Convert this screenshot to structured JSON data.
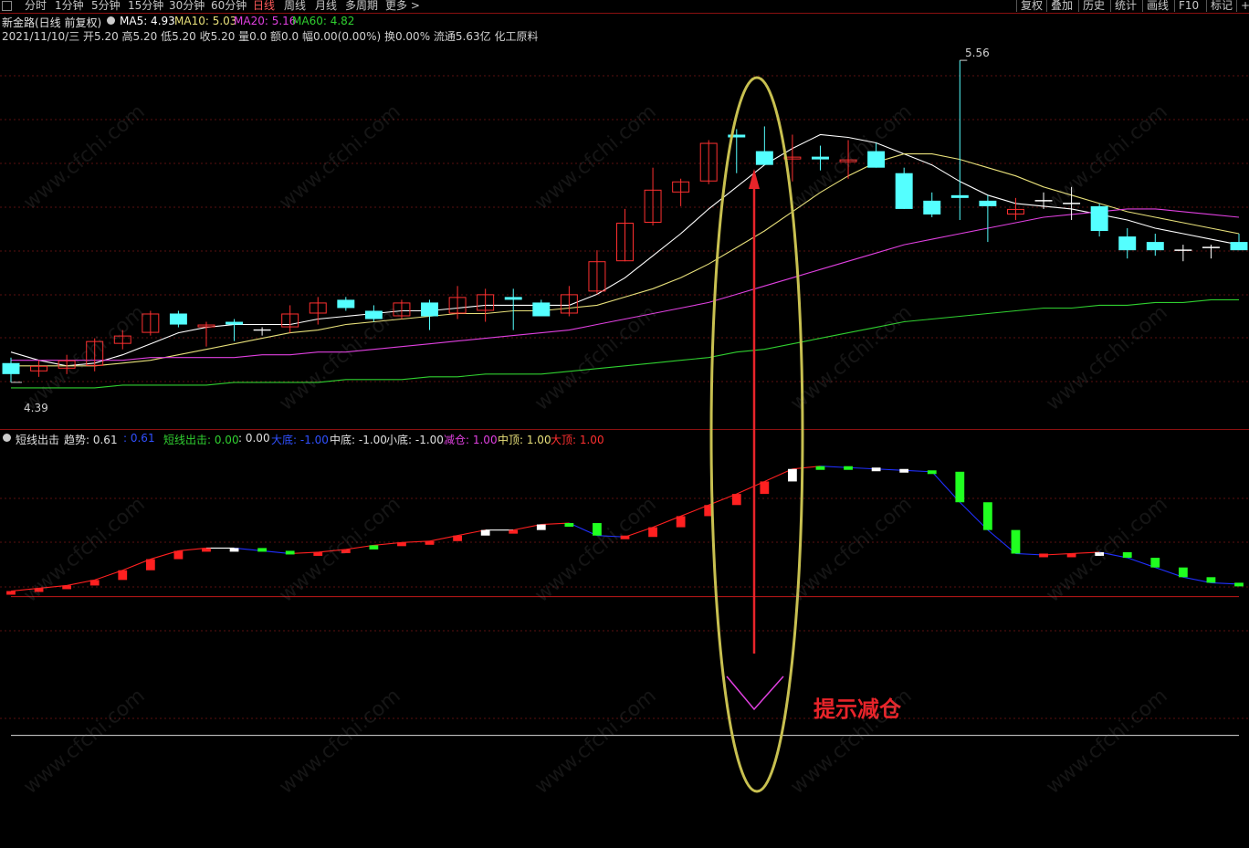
{
  "toolbar": {
    "periods": [
      "分时",
      "1分钟",
      "5分钟",
      "15分钟",
      "30分钟",
      "60分钟",
      "日线",
      "周线",
      "月线",
      "多周期",
      "更多 >"
    ],
    "active_period": "日线",
    "right_buttons": [
      "复权",
      "叠加",
      "历史",
      "统计",
      "画线",
      "F10",
      "标记",
      "+自"
    ]
  },
  "header": {
    "stock_name": "新金路(日线 前复权)",
    "ma5_label": "MA5: 4.93",
    "ma10_label": "MA10: 5.03",
    "ma20_label": "MA20: 5.16",
    "ma60_label": "MA60: 4.82",
    "quote_line": "2021/11/10/三 开5.20 高5.20 低5.20 收5.20 量0.0 额0.0 幅0.00(0.00%) 换0.00% 流通5.63亿 化工原料",
    "colors": {
      "ma5": "#ffffff",
      "ma10": "#e8e07a",
      "ma20": "#e040e0",
      "ma60": "#30d030"
    }
  },
  "indicator_header": {
    "name": "短线出击",
    "trend": "趋势: 0.61",
    "trend_val": ": 0.61",
    "short": "短线出击: 0.00",
    "short_val": ": 0.00",
    "big_bottom": "大底: -1.00",
    "mid_bottom": "中底: -1.00",
    "small_bottom": "小底: -1.00",
    "reduce": "减仓: 1.00",
    "mid_top": "中顶: 1.00",
    "big_top": "大顶: 1.00"
  },
  "annotations": {
    "high_label": "5.56",
    "low_label": "4.39",
    "signal_text": "提示减仓"
  },
  "watermark": "www.cfchi.com",
  "chart_data": [
    {
      "type": "candlestick",
      "title": "新金路(日线 前复权)",
      "ylim": [
        4.3,
        5.62
      ],
      "up_color": "#ff3030",
      "down_color": "#54ffff",
      "candles": [
        {
          "o": 4.46,
          "h": 4.48,
          "l": 4.39,
          "c": 4.42
        },
        {
          "o": 4.43,
          "h": 4.47,
          "l": 4.41,
          "c": 4.45
        },
        {
          "o": 4.44,
          "h": 4.49,
          "l": 4.42,
          "c": 4.47
        },
        {
          "o": 4.45,
          "h": 4.55,
          "l": 4.43,
          "c": 4.54
        },
        {
          "o": 4.53,
          "h": 4.58,
          "l": 4.51,
          "c": 4.56
        },
        {
          "o": 4.57,
          "h": 4.65,
          "l": 4.56,
          "c": 4.64
        },
        {
          "o": 4.64,
          "h": 4.65,
          "l": 4.59,
          "c": 4.6
        },
        {
          "o": 4.59,
          "h": 4.61,
          "l": 4.52,
          "c": 4.6
        },
        {
          "o": 4.61,
          "h": 4.62,
          "l": 4.54,
          "c": 4.6
        },
        {
          "o": 4.58,
          "h": 4.59,
          "l": 4.56,
          "c": 4.58
        },
        {
          "o": 4.59,
          "h": 4.67,
          "l": 4.57,
          "c": 4.64
        },
        {
          "o": 4.64,
          "h": 4.7,
          "l": 4.6,
          "c": 4.68
        },
        {
          "o": 4.69,
          "h": 4.7,
          "l": 4.65,
          "c": 4.66
        },
        {
          "o": 4.65,
          "h": 4.67,
          "l": 4.61,
          "c": 4.62
        },
        {
          "o": 4.63,
          "h": 4.69,
          "l": 4.62,
          "c": 4.68
        },
        {
          "o": 4.68,
          "h": 4.69,
          "l": 4.58,
          "c": 4.63
        },
        {
          "o": 4.64,
          "h": 4.74,
          "l": 4.62,
          "c": 4.7
        },
        {
          "o": 4.65,
          "h": 4.73,
          "l": 4.61,
          "c": 4.71
        },
        {
          "o": 4.7,
          "h": 4.73,
          "l": 4.58,
          "c": 4.69
        },
        {
          "o": 4.68,
          "h": 4.69,
          "l": 4.63,
          "c": 4.63
        },
        {
          "o": 4.64,
          "h": 4.74,
          "l": 4.63,
          "c": 4.71
        },
        {
          "o": 4.72,
          "h": 4.87,
          "l": 4.71,
          "c": 4.83
        },
        {
          "o": 4.83,
          "h": 5.02,
          "l": 4.83,
          "c": 4.97
        },
        {
          "o": 4.97,
          "h": 5.17,
          "l": 4.96,
          "c": 5.09
        },
        {
          "o": 5.08,
          "h": 5.13,
          "l": 5.03,
          "c": 5.12
        },
        {
          "o": 5.12,
          "h": 5.27,
          "l": 5.11,
          "c": 5.26
        },
        {
          "o": 5.29,
          "h": 5.31,
          "l": 5.15,
          "c": 5.28
        },
        {
          "o": 5.23,
          "h": 5.32,
          "l": 5.18,
          "c": 5.18
        },
        {
          "o": 5.2,
          "h": 5.29,
          "l": 5.12,
          "c": 5.21
        },
        {
          "o": 5.21,
          "h": 5.25,
          "l": 5.16,
          "c": 5.2
        },
        {
          "o": 5.19,
          "h": 5.27,
          "l": 5.13,
          "c": 5.2
        },
        {
          "o": 5.23,
          "h": 5.26,
          "l": 5.17,
          "c": 5.17
        },
        {
          "o": 5.15,
          "h": 5.17,
          "l": 5.02,
          "c": 5.02
        },
        {
          "o": 5.05,
          "h": 5.08,
          "l": 4.99,
          "c": 5.0
        },
        {
          "o": 5.07,
          "h": 5.56,
          "l": 4.98,
          "c": 5.06
        },
        {
          "o": 5.05,
          "h": 5.07,
          "l": 4.9,
          "c": 5.03
        },
        {
          "o": 5.0,
          "h": 5.06,
          "l": 4.98,
          "c": 5.02
        },
        {
          "o": 5.05,
          "h": 5.08,
          "l": 5.02,
          "c": 5.05
        },
        {
          "o": 5.04,
          "h": 5.1,
          "l": 4.98,
          "c": 5.04
        },
        {
          "o": 5.03,
          "h": 5.04,
          "l": 4.92,
          "c": 4.94
        },
        {
          "o": 4.92,
          "h": 4.95,
          "l": 4.84,
          "c": 4.87
        },
        {
          "o": 4.9,
          "h": 4.93,
          "l": 4.85,
          "c": 4.87
        },
        {
          "o": 4.87,
          "h": 4.89,
          "l": 4.83,
          "c": 4.87
        },
        {
          "o": 4.88,
          "h": 4.89,
          "l": 4.84,
          "c": 4.88
        },
        {
          "o": 4.9,
          "h": 4.93,
          "l": 4.87,
          "c": 4.87
        }
      ],
      "series": [
        {
          "name": "MA5",
          "color": "#ffffff",
          "values": [
            4.5,
            4.47,
            4.45,
            4.46,
            4.49,
            4.53,
            4.57,
            4.59,
            4.6,
            4.6,
            4.6,
            4.62,
            4.63,
            4.64,
            4.65,
            4.65,
            4.66,
            4.67,
            4.67,
            4.67,
            4.67,
            4.71,
            4.77,
            4.85,
            4.93,
            5.02,
            5.1,
            5.18,
            5.24,
            5.29,
            5.28,
            5.26,
            5.22,
            5.18,
            5.12,
            5.07,
            5.04,
            5.03,
            5.02,
            5.0,
            4.98,
            4.95,
            4.93,
            4.91,
            4.89
          ]
        },
        {
          "name": "MA10",
          "color": "#e8e07a",
          "values": [
            4.45,
            4.45,
            4.45,
            4.45,
            4.46,
            4.47,
            4.49,
            4.51,
            4.53,
            4.55,
            4.57,
            4.58,
            4.6,
            4.61,
            4.62,
            4.63,
            4.64,
            4.64,
            4.65,
            4.65,
            4.66,
            4.67,
            4.7,
            4.73,
            4.77,
            4.82,
            4.88,
            4.94,
            5.01,
            5.08,
            5.14,
            5.19,
            5.22,
            5.22,
            5.2,
            5.17,
            5.14,
            5.1,
            5.07,
            5.04,
            5.01,
            4.99,
            4.97,
            4.95,
            4.93
          ]
        },
        {
          "name": "MA20",
          "color": "#e040e0",
          "values": [
            4.47,
            4.47,
            4.47,
            4.47,
            4.47,
            4.48,
            4.48,
            4.48,
            4.48,
            4.49,
            4.49,
            4.5,
            4.5,
            4.51,
            4.52,
            4.53,
            4.54,
            4.55,
            4.56,
            4.57,
            4.58,
            4.6,
            4.62,
            4.64,
            4.66,
            4.68,
            4.71,
            4.74,
            4.77,
            4.8,
            4.83,
            4.86,
            4.89,
            4.91,
            4.93,
            4.95,
            4.97,
            4.99,
            5.0,
            5.01,
            5.02,
            5.02,
            5.01,
            5.0,
            4.99
          ]
        },
        {
          "name": "MA60",
          "color": "#30d030",
          "values": [
            4.37,
            4.37,
            4.37,
            4.37,
            4.38,
            4.38,
            4.38,
            4.38,
            4.39,
            4.39,
            4.39,
            4.39,
            4.4,
            4.4,
            4.4,
            4.41,
            4.41,
            4.42,
            4.42,
            4.42,
            4.43,
            4.44,
            4.45,
            4.46,
            4.47,
            4.48,
            4.5,
            4.51,
            4.53,
            4.55,
            4.57,
            4.59,
            4.61,
            4.62,
            4.63,
            4.64,
            4.65,
            4.66,
            4.66,
            4.67,
            4.67,
            4.68,
            4.68,
            4.69,
            4.69
          ]
        }
      ]
    },
    {
      "type": "bar",
      "title": "短线出击",
      "ylim": [
        -1.2,
        1.05
      ],
      "reference_lines": [
        0,
        -1
      ],
      "up_color": "#ff2020",
      "down_color": "#20ff20",
      "trend_values": [
        0.04,
        0.06,
        0.08,
        0.12,
        0.19,
        0.27,
        0.33,
        0.35,
        0.35,
        0.33,
        0.31,
        0.32,
        0.34,
        0.37,
        0.39,
        0.4,
        0.44,
        0.48,
        0.48,
        0.52,
        0.53,
        0.44,
        0.43,
        0.5,
        0.58,
        0.66,
        0.74,
        0.83,
        0.92,
        0.94,
        0.93,
        0.92,
        0.91,
        0.9,
        0.68,
        0.48,
        0.31,
        0.3,
        0.31,
        0.32,
        0.28,
        0.21,
        0.14,
        0.1,
        0.09
      ],
      "bar_colors": [
        "up",
        "up",
        "up",
        "up",
        "up",
        "up",
        "up",
        "up",
        "flat",
        "down",
        "down",
        "up",
        "up",
        "down",
        "up",
        "up",
        "up",
        "flat",
        "up",
        "flat",
        "down",
        "down",
        "up",
        "up",
        "up",
        "up",
        "up",
        "up",
        "flat",
        "down",
        "down",
        "flat",
        "flat",
        "down",
        "down",
        "down",
        "down",
        "up",
        "up",
        "flat",
        "down",
        "down",
        "down",
        "down",
        "down"
      ]
    }
  ]
}
